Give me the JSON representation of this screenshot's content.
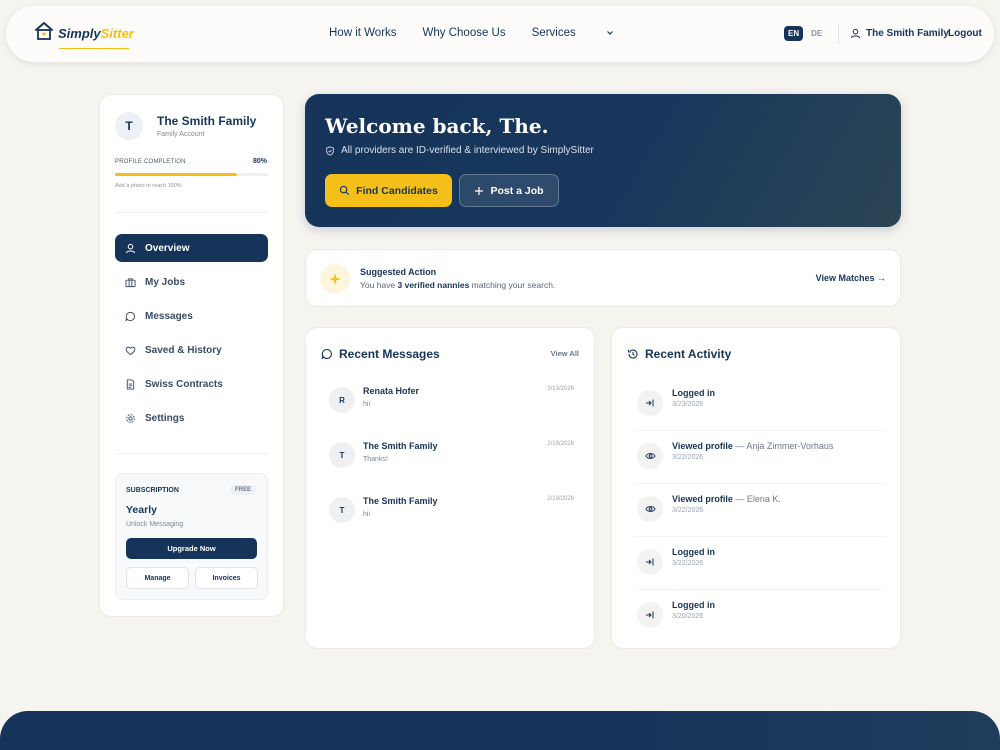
{
  "brand": {
    "name_main": "Simply",
    "name_accent": "Sitter",
    "accent_color": "#f3bf18",
    "primary_color": "#16345a"
  },
  "nav": {
    "links": [
      "How it Works",
      "Why Choose Us",
      "Services"
    ],
    "lang_active": "EN",
    "lang_other": "DE",
    "user_name": "The Smith Family",
    "logout": "Logout"
  },
  "profile": {
    "initial": "T",
    "name": "The Smith Family",
    "role": "Family Account",
    "completion_label": "PROFILE COMPLETION",
    "completion_value": "80%",
    "completion_fraction": 0.8,
    "completion_hint": "Add a photo to reach 100%"
  },
  "sidebar": {
    "items": [
      {
        "label": "Overview",
        "icon": "user-icon",
        "active": true
      },
      {
        "label": "My Jobs",
        "icon": "briefcase-icon"
      },
      {
        "label": "Messages",
        "icon": "chat-icon"
      },
      {
        "label": "Saved & History",
        "icon": "heart-icon"
      },
      {
        "label": "Swiss Contracts",
        "icon": "document-icon"
      },
      {
        "label": "Settings",
        "icon": "gear-icon"
      }
    ]
  },
  "subscription": {
    "title": "SUBSCRIPTION",
    "badge": "FREE",
    "plan": "Yearly",
    "desc": "Unlock Messaging",
    "upgrade": "Upgrade Now",
    "manage": "Manage",
    "invoices": "Invoices"
  },
  "hero": {
    "title": "Welcome back, The.",
    "subtitle": "All providers are ID-verified & interviewed by SimplySitter",
    "find_btn": "Find Candidates",
    "post_btn": "Post a Job"
  },
  "suggestion": {
    "title": "Suggested Action",
    "text_pre": "You have ",
    "text_bold": "3 verified nannies",
    "text_post": " matching your search.",
    "link": "View Matches →"
  },
  "messages": {
    "title": "Recent Messages",
    "view_all": "View All",
    "items": [
      {
        "initial": "R",
        "name": "Renata Hofer",
        "text": "hii",
        "date": "3/13/2026"
      },
      {
        "initial": "T",
        "name": "The Smith Family",
        "text": "Thanks!",
        "date": "2/19/2026"
      },
      {
        "initial": "T",
        "name": "The Smith Family",
        "text": "hii",
        "date": "2/19/2026"
      }
    ]
  },
  "activity": {
    "title": "Recent Activity",
    "items": [
      {
        "icon": "login-icon",
        "title": "Logged in",
        "extra": "",
        "date": "3/23/2026"
      },
      {
        "icon": "eye-icon",
        "title": "Viewed profile",
        "extra": " — Anja Zimmer-Vorhaus",
        "date": "3/22/2026"
      },
      {
        "icon": "eye-icon",
        "title": "Viewed profile",
        "extra": " — Elena K.",
        "date": "3/22/2026"
      },
      {
        "icon": "login-icon",
        "title": "Logged in",
        "extra": "",
        "date": "3/22/2026"
      },
      {
        "icon": "login-icon",
        "title": "Logged in",
        "extra": "",
        "date": "3/20/2026"
      }
    ]
  }
}
